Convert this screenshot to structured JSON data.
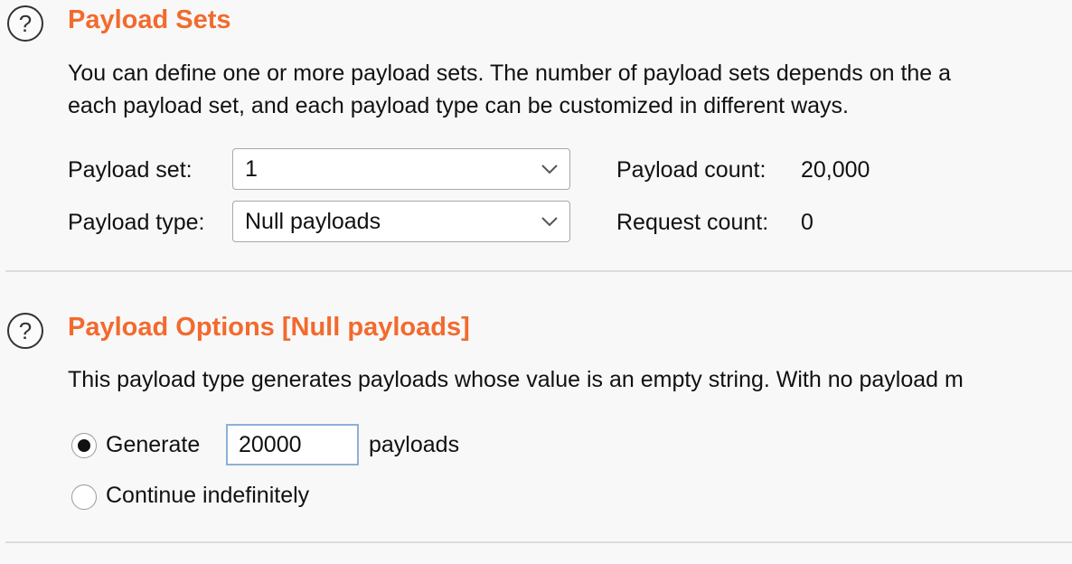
{
  "payload_sets": {
    "title": "Payload Sets",
    "description_line1": "You can define one or more payload sets. The number of payload sets depends on the a",
    "description_line2": "each payload set, and each payload type can be customized in different ways.",
    "payload_set_label": "Payload set:",
    "payload_set_value": "1",
    "payload_type_label": "Payload type:",
    "payload_type_value": "Null payloads",
    "payload_count_label": "Payload count:",
    "payload_count_value": "20,000",
    "request_count_label": "Request count:",
    "request_count_value": "0"
  },
  "payload_options": {
    "title": "Payload Options [Null payloads]",
    "description": "This payload type generates payloads whose value is an empty string. With no payload m",
    "generate_label": "Generate",
    "generate_value": "20000",
    "payloads_suffix": "payloads",
    "continue_label": "Continue indefinitely",
    "selected_option": "generate"
  },
  "icons": {
    "help": "?"
  },
  "colors": {
    "title": "#f26a2e",
    "input_border_focus": "#8fb0d6",
    "separator": "#dcdcdc"
  }
}
